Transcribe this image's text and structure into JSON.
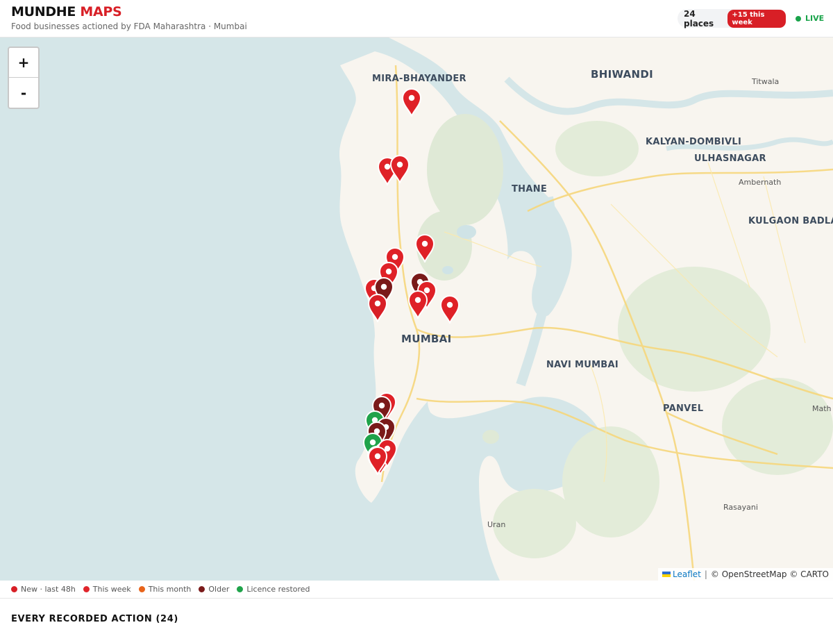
{
  "header": {
    "brand_part1": "MUNDHE",
    "brand_part2": "MAPS",
    "subtitle": "Food businesses actioned by FDA Maharashtra · Mumbai",
    "places_count": "24 places",
    "week_badge": "+15 this week",
    "live_label": "LIVE"
  },
  "map": {
    "zoom_in": "+",
    "zoom_out": "-",
    "labels": [
      {
        "id": "mira",
        "text": "MIRA-BHAYANDER"
      },
      {
        "id": "bhiwandi",
        "text": "BHIWANDI"
      },
      {
        "id": "titwala",
        "text": "Titwala"
      },
      {
        "id": "kalyan",
        "text": "KALYAN-DOMBIVLI"
      },
      {
        "id": "ulhas",
        "text": "ULHASNAGAR"
      },
      {
        "id": "thane",
        "text": "THANE"
      },
      {
        "id": "ambernath",
        "text": "Ambernath"
      },
      {
        "id": "kulgaon",
        "text": "KULGAON BADLAP"
      },
      {
        "id": "mumbai",
        "text": "MUMBAI"
      },
      {
        "id": "navi",
        "text": "NAVI MUMBAI"
      },
      {
        "id": "panvel",
        "text": "PANVEL"
      },
      {
        "id": "math",
        "text": "Math"
      },
      {
        "id": "uran",
        "text": "Uran"
      },
      {
        "id": "rasayani",
        "text": "Rasayani"
      }
    ],
    "attribution": {
      "leaflet": "Leaflet",
      "separator": "|",
      "credits": "© OpenStreetMap © CARTO"
    }
  },
  "markers": [
    {
      "status": "this_week"
    },
    {
      "status": "this_week"
    },
    {
      "status": "this_week"
    },
    {
      "status": "this_week"
    },
    {
      "status": "this_week"
    },
    {
      "status": "this_week"
    },
    {
      "status": "older"
    },
    {
      "status": "this_week"
    },
    {
      "status": "older"
    },
    {
      "status": "this_week"
    },
    {
      "status": "this_week"
    },
    {
      "status": "new"
    },
    {
      "status": "this_week"
    },
    {
      "status": "this_week"
    },
    {
      "status": "older"
    },
    {
      "status": "restored"
    },
    {
      "status": "older"
    },
    {
      "status": "older"
    },
    {
      "status": "restored"
    },
    {
      "status": "this_week"
    },
    {
      "status": "this_week"
    },
    {
      "status": "this_week"
    },
    {
      "status": "this_week"
    },
    {
      "status": "this_week"
    }
  ],
  "legend": {
    "items": [
      {
        "label": "New · last 48h",
        "color": "#d81f26"
      },
      {
        "label": "This week",
        "color": "#e0252b"
      },
      {
        "label": "This month",
        "color": "#e8641b"
      },
      {
        "label": "Older",
        "color": "#7a1a1a"
      },
      {
        "label": "Licence restored",
        "color": "#1fa34a"
      }
    ]
  },
  "colors": {
    "new": "#d81f26",
    "this_week": "#df2127",
    "this_month": "#e8641b",
    "older": "#7a1a1a",
    "restored": "#1fa34a",
    "accent": "#d81f26",
    "live": "#19a34a"
  },
  "actions": {
    "title": "EVERY RECORDED ACTION (24)"
  }
}
